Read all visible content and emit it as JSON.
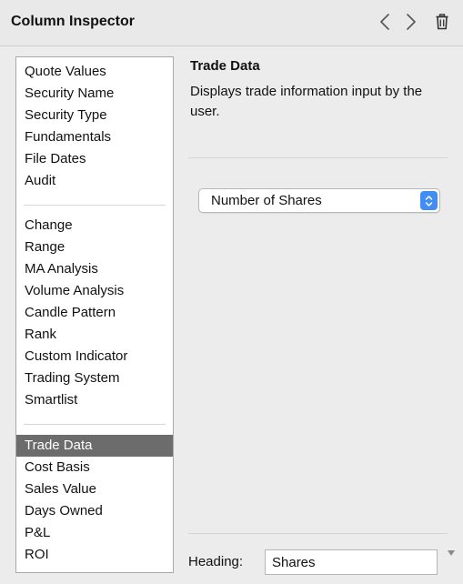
{
  "window": {
    "title": "Column Inspector"
  },
  "toolbar": {
    "back_icon": "chevron-left-icon",
    "forward_icon": "chevron-right-icon",
    "delete_icon": "trash-icon"
  },
  "sidebar": {
    "groups": [
      {
        "items": [
          {
            "label": "Quote Values"
          },
          {
            "label": "Security Name"
          },
          {
            "label": "Security Type"
          },
          {
            "label": "Fundamentals"
          },
          {
            "label": "File Dates"
          },
          {
            "label": "Audit"
          }
        ]
      },
      {
        "items": [
          {
            "label": "Change"
          },
          {
            "label": "Range"
          },
          {
            "label": "MA Analysis"
          },
          {
            "label": "Volume Analysis"
          },
          {
            "label": "Candle Pattern"
          },
          {
            "label": "Rank"
          },
          {
            "label": "Custom Indicator"
          },
          {
            "label": "Trading System"
          },
          {
            "label": "Smartlist"
          }
        ]
      },
      {
        "items": [
          {
            "label": "Trade Data",
            "selected": true
          },
          {
            "label": "Cost Basis"
          },
          {
            "label": "Sales Value"
          },
          {
            "label": "Days Owned"
          },
          {
            "label": "P&L"
          },
          {
            "label": "ROI"
          }
        ]
      }
    ]
  },
  "detail": {
    "title": "Trade Data",
    "description": "Displays trade information input by the user.",
    "select_value": "Number of Shares"
  },
  "heading": {
    "label": "Heading:",
    "value": "Shares"
  },
  "colors": {
    "selection": "#6c6c6c",
    "accent": "#3f8df5",
    "background": "#ececec"
  }
}
